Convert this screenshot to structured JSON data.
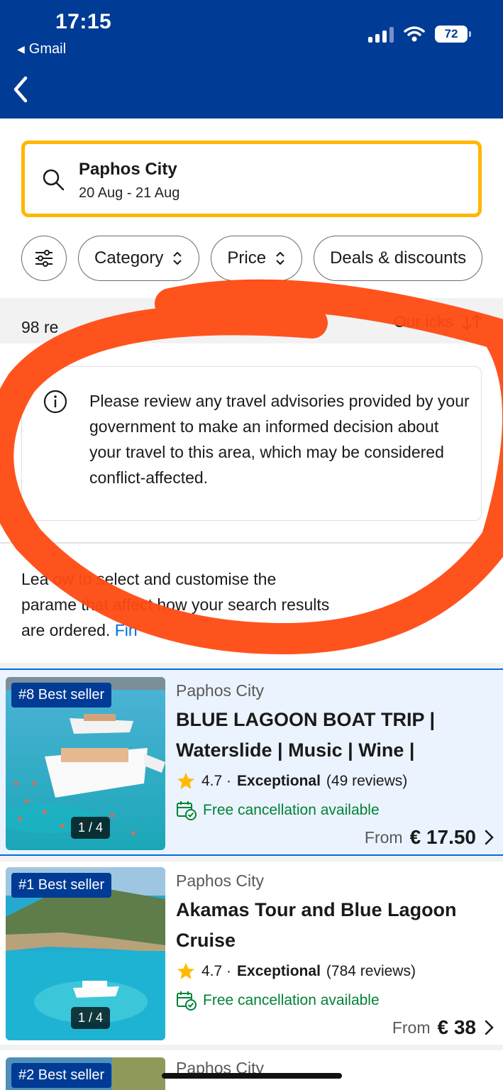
{
  "status_bar": {
    "time": "17:15",
    "back_app": "Gmail",
    "battery": "72"
  },
  "search": {
    "location": "Paphos City",
    "dates": "20 Aug - 21 Aug"
  },
  "filters": {
    "category": "Category",
    "price": "Price",
    "deals": "Deals & discounts"
  },
  "results": {
    "count": "98 re",
    "sort": "Our    icks"
  },
  "advisory": {
    "text": "Please review any travel advisories provided by your government to make an informed decision about your travel to this area, which may be considered conflict-affected."
  },
  "learn": {
    "text_1": "Lea    ow to select and customise the",
    "text_2": "parame    that affect how your search results",
    "text_3": "are ordered.",
    "link": "Fin"
  },
  "cards": [
    {
      "badge": "#8 Best seller",
      "counter": "1 / 4",
      "location": "Paphos City",
      "title": "BLUE LAGOON BOAT TRIP | Waterslide | Music | Wine |",
      "rating": "4.7 ·",
      "rating_word": "Exceptional",
      "reviews": "(49 reviews)",
      "free_cancellation": "Free cancellation available",
      "price_prefix": "From",
      "price": "€ 17.50"
    },
    {
      "badge": "#1 Best seller",
      "counter": "1 / 4",
      "location": "Paphos City",
      "title": "Akamas Tour and Blue Lagoon Cruise",
      "rating": "4.7 ·",
      "rating_word": "Exceptional",
      "reviews": "(784 reviews)",
      "free_cancellation": "Free cancellation available",
      "price_prefix": "From",
      "price": "€ 38"
    },
    {
      "badge": "#2 Best seller",
      "location": "Paphos City"
    }
  ],
  "colors": {
    "brand": "#003b95",
    "accent": "#006ce4",
    "search_border": "#ffb700",
    "green": "#008234",
    "annotation": "#ff4a12",
    "star": "#febb02"
  },
  "icons": [
    "chevron-left-icon",
    "search-icon",
    "filter-sliders-icon",
    "updown-chevron-icon",
    "sort-arrows-icon",
    "info-icon",
    "star-icon",
    "calendar-check-icon",
    "chevron-right-icon",
    "signal-icon",
    "wifi-icon",
    "battery-icon"
  ]
}
